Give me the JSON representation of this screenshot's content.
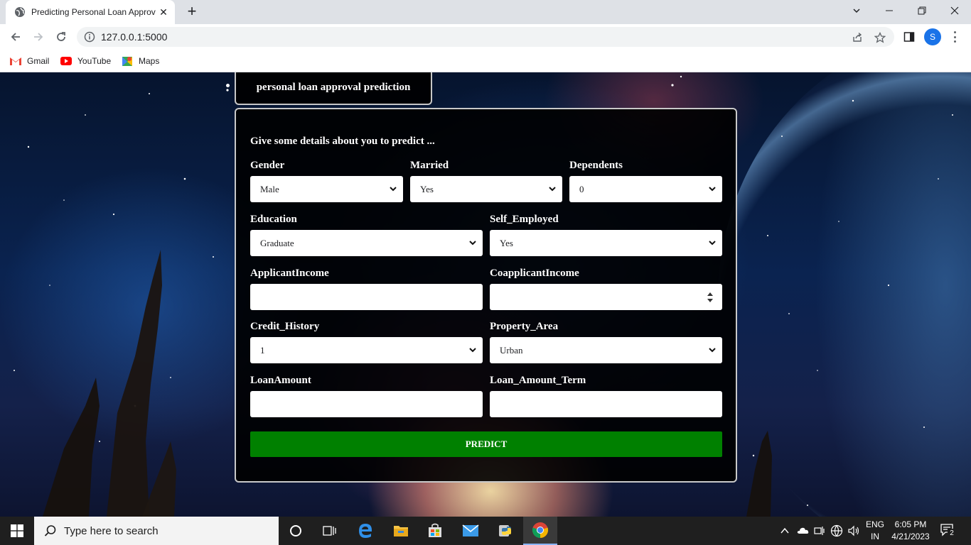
{
  "browser": {
    "tab_title": "Predicting Personal Loan Approv",
    "url": "127.0.0.1:5000",
    "profile_initial": "S",
    "bookmarks": [
      {
        "label": "Gmail",
        "icon": "gmail-icon"
      },
      {
        "label": "YouTube",
        "icon": "youtube-icon"
      },
      {
        "label": "Maps",
        "icon": "maps-icon"
      }
    ]
  },
  "page": {
    "header_title": "personal loan approval prediction",
    "intro": "Give some details about you to predict ...",
    "fields": {
      "gender": {
        "label": "Gender",
        "value": "Male"
      },
      "married": {
        "label": "Married",
        "value": "Yes"
      },
      "dependents": {
        "label": "Dependents",
        "value": "0"
      },
      "education": {
        "label": "Education",
        "value": "Graduate"
      },
      "self_employed": {
        "label": "Self_Employed",
        "value": "Yes"
      },
      "applicant_income": {
        "label": "ApplicantIncome",
        "value": ""
      },
      "coapplicant_income": {
        "label": "CoapplicantIncome",
        "value": ""
      },
      "credit_history": {
        "label": "Credit_History",
        "value": "1"
      },
      "property_area": {
        "label": "Property_Area",
        "value": "Urban"
      },
      "loan_amount": {
        "label": "LoanAmount",
        "value": ""
      },
      "loan_amount_term": {
        "label": "Loan_Amount_Term",
        "value": ""
      }
    },
    "predict_label": "PREDICT"
  },
  "taskbar": {
    "search_placeholder": "Type here to search",
    "language_line1": "ENG",
    "language_line2": "IN",
    "time": "6:05 PM",
    "date": "4/21/2023",
    "notification_count": "2"
  },
  "colors": {
    "predict_button": "#008000",
    "chrome_titlebar": "#dee1e6",
    "profile_avatar": "#1a73e8"
  }
}
